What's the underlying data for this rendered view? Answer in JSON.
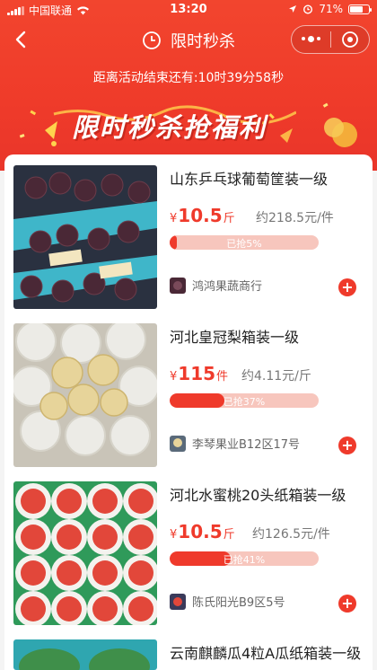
{
  "status": {
    "carrier": "中国联通",
    "time": "13:20",
    "battery": "71%",
    "battery_level": 0.71
  },
  "nav": {
    "title": "限时秒杀"
  },
  "countdown": "距离活动结束还有:10时39分58秒",
  "banner": "限时秒杀抢福利",
  "colors": {
    "primary": "#ef3a2b",
    "progress_track": "#f7c6bd"
  },
  "items": [
    {
      "title": "山东乒乓球葡萄筐装一级",
      "currency": "¥",
      "price": "10.5",
      "unit": "斤",
      "per_unit": "约218.5元/件",
      "sold_label": "已抢5%",
      "sold": 0.05,
      "seller": "鸿鸿果蔬商行"
    },
    {
      "title": "河北皇冠梨箱装一级",
      "currency": "¥",
      "price": "115",
      "unit": "件",
      "per_unit": "约4.11元/斤",
      "sold_label": "已抢37%",
      "sold": 0.37,
      "seller": "李琴果业B12区17号"
    },
    {
      "title": "河北水蜜桃20头纸箱装一级",
      "currency": "¥",
      "price": "10.5",
      "unit": "斤",
      "per_unit": "约126.5元/件",
      "sold_label": "已抢41%",
      "sold": 0.41,
      "seller": "陈氏阳光B9区5号"
    },
    {
      "title": "云南麒麟瓜4粒A瓜纸箱装一级"
    }
  ],
  "add_icon": "+"
}
